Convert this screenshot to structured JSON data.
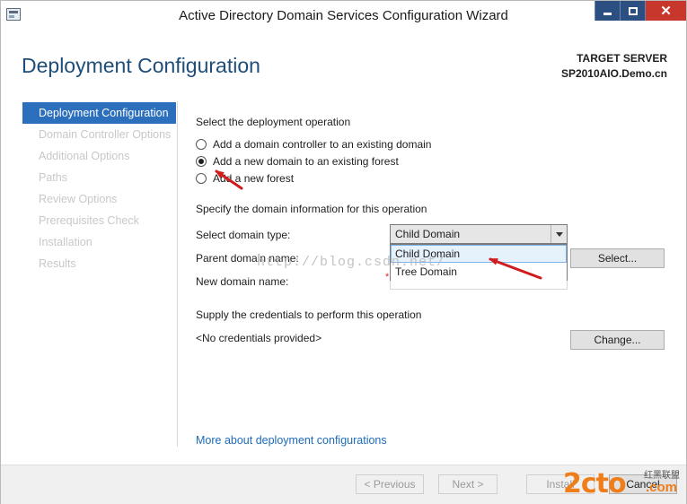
{
  "window": {
    "title": "Active Directory Domain Services Configuration Wizard",
    "controls": {
      "minimize": "",
      "maximize": "",
      "close": "✕"
    }
  },
  "header": {
    "page_title": "Deployment Configuration",
    "target_label": "TARGET SERVER",
    "target_server": "SP2010AIO.Demo.cn"
  },
  "nav": {
    "items": [
      {
        "label": "Deployment Configuration",
        "active": true
      },
      {
        "label": "Domain Controller Options",
        "active": false
      },
      {
        "label": "Additional Options",
        "active": false
      },
      {
        "label": "Paths",
        "active": false
      },
      {
        "label": "Review Options",
        "active": false
      },
      {
        "label": "Prerequisites Check",
        "active": false
      },
      {
        "label": "Installation",
        "active": false
      },
      {
        "label": "Results",
        "active": false
      }
    ]
  },
  "main": {
    "operation_heading": "Select the deployment operation",
    "options": [
      {
        "label": "Add a domain controller to an existing domain",
        "checked": false
      },
      {
        "label": "Add a new domain to an existing forest",
        "checked": true
      },
      {
        "label": "Add a new forest",
        "checked": false
      }
    ],
    "domain_heading": "Specify the domain information for this operation",
    "domain_type_label": "Select domain type:",
    "domain_type_value": "Child Domain",
    "domain_type_options": [
      "Child Domain",
      "Tree Domain"
    ],
    "parent_domain_label": "Parent domain name:",
    "new_domain_label": "New domain name:",
    "required_marker": "*",
    "select_button": "Select...",
    "credentials_heading": "Supply the credentials to perform this operation",
    "credentials_value": "<No credentials provided>",
    "change_button": "Change...",
    "more_link": "More about deployment configurations"
  },
  "footer": {
    "previous": "< Previous",
    "next": "Next >",
    "install": "Install",
    "cancel": "Cancel"
  },
  "overlay": {
    "watermark": "http://blog.csdn.net/",
    "logo": "2cto",
    "logo_tagline": "红黑联盟",
    "logo_domain": ".com"
  },
  "colors": {
    "accent": "#2b6fbd",
    "title_blue": "#1e4e79",
    "link": "#1c6bb8",
    "annotation_red": "#d01c1c",
    "close_red": "#c7372b",
    "logo_orange": "#ef7d1a"
  }
}
